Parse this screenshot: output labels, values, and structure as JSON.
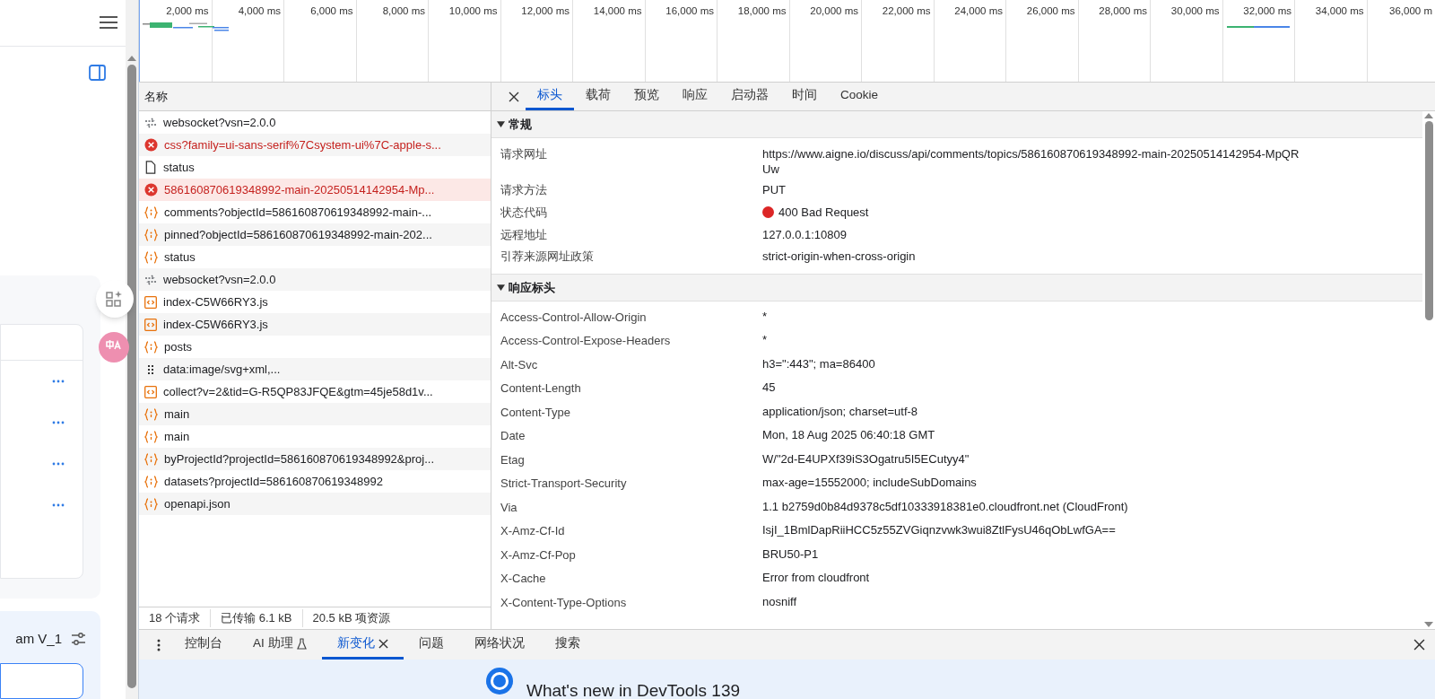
{
  "page": {
    "project_label": "am V_1"
  },
  "timeline": {
    "ticks": [
      "2,000 ms",
      "4,000 ms",
      "6,000 ms",
      "8,000 ms",
      "10,000 ms",
      "12,000 ms",
      "14,000 ms",
      "16,000 ms",
      "18,000 ms",
      "20,000 ms",
      "22,000 ms",
      "24,000 ms",
      "26,000 ms",
      "28,000 ms",
      "30,000 ms",
      "32,000 ms",
      "34,000 ms",
      "36,000 m"
    ]
  },
  "requests": {
    "column": "名称",
    "rows": [
      {
        "kind": "websocket",
        "name": "websocket?vsn=2.0.0",
        "error": false,
        "selected": false
      },
      {
        "kind": "error",
        "name": "css?family=ui-sans-serif%7Csystem-ui%7C-apple-s...",
        "error": true,
        "selected": false
      },
      {
        "kind": "document",
        "name": "status",
        "error": false,
        "selected": false
      },
      {
        "kind": "error",
        "name": "586160870619348992-main-20250514142954-Mp...",
        "error": true,
        "selected": true
      },
      {
        "kind": "fetch",
        "name": "comments?objectId=586160870619348992-main-...",
        "error": false,
        "selected": false
      },
      {
        "kind": "fetch",
        "name": "pinned?objectId=586160870619348992-main-202...",
        "error": false,
        "selected": false
      },
      {
        "kind": "fetch",
        "name": "status",
        "error": false,
        "selected": false
      },
      {
        "kind": "websocket",
        "name": "websocket?vsn=2.0.0",
        "error": false,
        "selected": false
      },
      {
        "kind": "script",
        "name": "index-C5W66RY3.js",
        "error": false,
        "selected": false
      },
      {
        "kind": "script",
        "name": "index-C5W66RY3.js",
        "error": false,
        "selected": false
      },
      {
        "kind": "fetch",
        "name": "posts",
        "error": false,
        "selected": false
      },
      {
        "kind": "image",
        "name": "data:image/svg+xml,...",
        "error": false,
        "selected": false
      },
      {
        "kind": "script",
        "name": "collect?v=2&tid=G-R5QP83JFQE&gtm=45je58d1v...",
        "error": false,
        "selected": false
      },
      {
        "kind": "fetch",
        "name": "main",
        "error": false,
        "selected": false
      },
      {
        "kind": "fetch",
        "name": "main",
        "error": false,
        "selected": false
      },
      {
        "kind": "fetch",
        "name": "byProjectId?projectId=586160870619348992&proj...",
        "error": false,
        "selected": false
      },
      {
        "kind": "fetch",
        "name": "datasets?projectId=586160870619348992",
        "error": false,
        "selected": false
      },
      {
        "kind": "fetch",
        "name": "openapi.json",
        "error": false,
        "selected": false
      }
    ],
    "status": [
      "18 个请求",
      "已传输 6.1 kB",
      "20.5 kB 项资源"
    ]
  },
  "details": {
    "tabs": [
      {
        "label": "标头",
        "selected": true
      },
      {
        "label": "载荷",
        "selected": false
      },
      {
        "label": "预览",
        "selected": false
      },
      {
        "label": "响应",
        "selected": false
      },
      {
        "label": "启动器",
        "selected": false
      },
      {
        "label": "时间",
        "selected": false
      },
      {
        "label": "Cookie",
        "selected": false
      }
    ],
    "sections": [
      {
        "title": "常规",
        "expanded": true,
        "compact": true,
        "rows": [
          {
            "key": "请求网址",
            "value": "https://www.aigne.io/discuss/api/comments/topics/586160870619348992-main-20250514142954-MpQRUw"
          },
          {
            "key": "请求方法",
            "value": "PUT"
          },
          {
            "key": "状态代码",
            "value": "400 Bad Request",
            "color": "#dc2626"
          },
          {
            "key": "远程地址",
            "value": "127.0.0.1:10809"
          },
          {
            "key": "引荐来源网址政策",
            "value": "strict-origin-when-cross-origin"
          }
        ]
      },
      {
        "title": "响应标头",
        "expanded": true,
        "compact": false,
        "rows": [
          {
            "key": "Access-Control-Allow-Origin",
            "value": "*"
          },
          {
            "key": "Access-Control-Expose-Headers",
            "value": "*"
          },
          {
            "key": "Alt-Svc",
            "value": "h3=\":443\"; ma=86400"
          },
          {
            "key": "Content-Length",
            "value": "45"
          },
          {
            "key": "Content-Type",
            "value": "application/json; charset=utf-8"
          },
          {
            "key": "Date",
            "value": "Mon, 18 Aug 2025 06:40:18 GMT"
          },
          {
            "key": "Etag",
            "value": "W/\"2d-E4UPXf39iS3Ogatru5I5ECutyy4\""
          },
          {
            "key": "Strict-Transport-Security",
            "value": "max-age=15552000; includeSubDomains"
          },
          {
            "key": "Via",
            "value": "1.1 b2759d0b84d9378c5df10333918381e0.cloudfront.net (CloudFront)"
          },
          {
            "key": "X-Amz-Cf-Id",
            "value": "IsjI_1BmlDapRiiHCC5z55ZVGiqnzvwk3wui8ZtlFysU46qObLwfGA=="
          },
          {
            "key": "X-Amz-Cf-Pop",
            "value": "BRU50-P1"
          },
          {
            "key": "X-Cache",
            "value": "Error from cloudfront"
          },
          {
            "key": "X-Content-Type-Options",
            "value": "nosniff"
          }
        ]
      }
    ]
  },
  "drawer": {
    "tabs": [
      {
        "label": "控制台",
        "selected": false,
        "closable": false,
        "experimental": false
      },
      {
        "label": "AI 助理",
        "selected": false,
        "closable": false,
        "experimental": true
      },
      {
        "label": "新变化",
        "selected": true,
        "closable": true,
        "experimental": false
      },
      {
        "label": "问题",
        "selected": false,
        "closable": false,
        "experimental": false
      },
      {
        "label": "网络状况",
        "selected": false,
        "closable": false,
        "experimental": false
      },
      {
        "label": "搜索",
        "selected": false,
        "closable": false,
        "experimental": false
      }
    ],
    "heading": "What's new in DevTools 139"
  }
}
